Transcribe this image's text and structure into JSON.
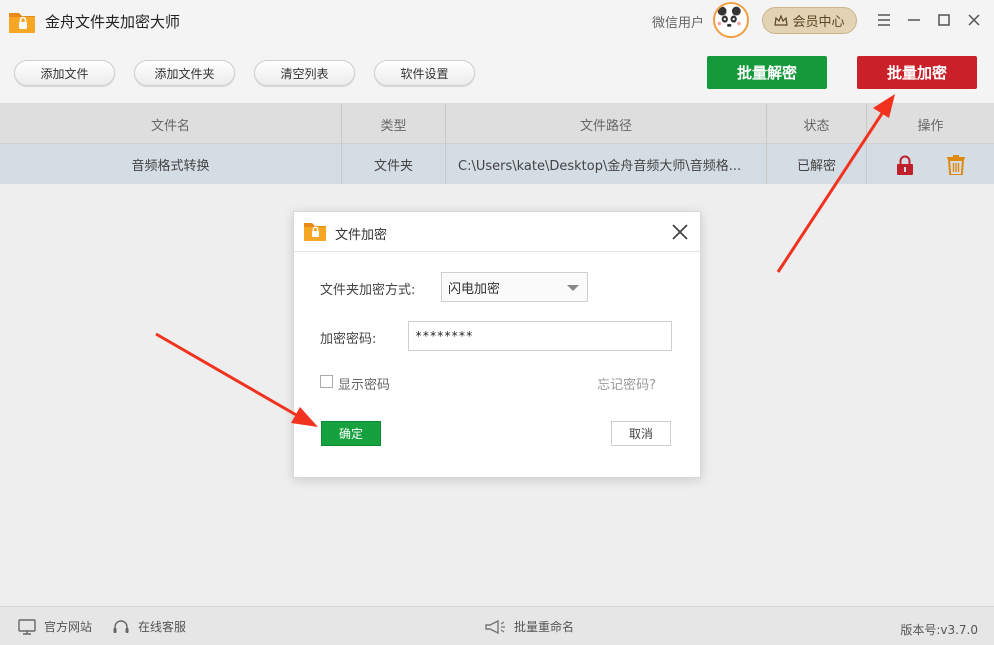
{
  "app": {
    "title": "金舟文件夹加密大师",
    "wechat_user": "微信用户",
    "vip_label": "会员中心"
  },
  "toolbar": {
    "add_file": "添加文件",
    "add_folder": "添加文件夹",
    "clear_list": "清空列表",
    "settings": "软件设置",
    "batch_decrypt": "批量解密",
    "batch_encrypt": "批量加密"
  },
  "table": {
    "headers": [
      "文件名",
      "类型",
      "文件路径",
      "状态",
      "操作"
    ],
    "rows": [
      {
        "name": "音频格式转换",
        "type": "文件夹",
        "path": "C:\\Users\\kate\\Desktop\\金舟音频大师\\音频格...",
        "status": "已解密"
      }
    ]
  },
  "dialog": {
    "title": "文件加密",
    "method_label": "文件夹加密方式:",
    "method_value": "闪电加密",
    "password_label": "加密密码:",
    "password_value": "********",
    "show_password": "显示密码",
    "forgot_password": "忘记密码?",
    "ok": "确定",
    "cancel": "取消"
  },
  "statusbar": {
    "website": "官方网站",
    "support": "在线客服",
    "batch_rename": "批量重命名",
    "version": "版本号:v3.7.0"
  },
  "colors": {
    "encrypt_red": "#c9202a",
    "decrypt_green": "#149a3a",
    "ok_green": "#16a13f",
    "lock_red": "#c0202a",
    "trash_orange": "#e08a10",
    "arrow_red": "#f0321e"
  }
}
